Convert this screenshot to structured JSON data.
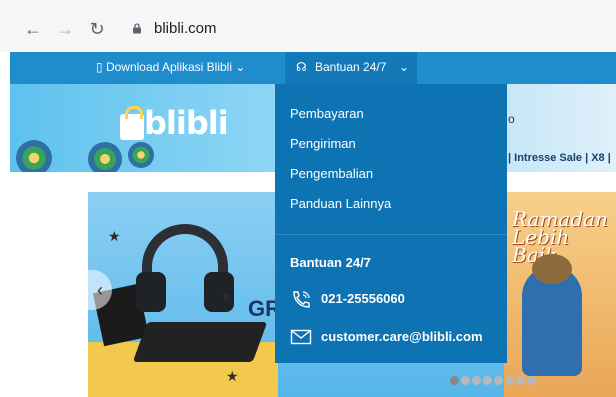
{
  "browser": {
    "url": "blibli.com",
    "icons": {
      "back": "arrow-left-icon",
      "forward": "arrow-right-icon",
      "reload": "reload-icon",
      "lock": "lock-icon"
    }
  },
  "topbar": {
    "download_label": "Download Aplikasi Blibli",
    "help_label": "Bantuan 24/7"
  },
  "header": {
    "logo_text": "blibli",
    "ticker": "| Intresse Sale | X8 |",
    "search_fragment": "o"
  },
  "dropdown": {
    "links": [
      "Pembayaran",
      "Pengiriman",
      "Pengembalian",
      "Panduan Lainnya"
    ],
    "support_title": "Bantuan 24/7",
    "phone": "021-25556060",
    "email": "customer.care@blibli.com"
  },
  "promo": {
    "partial_text": "GR",
    "side_banner_title": "Ramadan Lebih Baik"
  },
  "colors": {
    "brand_blue": "#1f8ccc",
    "dropdown_blue": "#0d73b3"
  }
}
